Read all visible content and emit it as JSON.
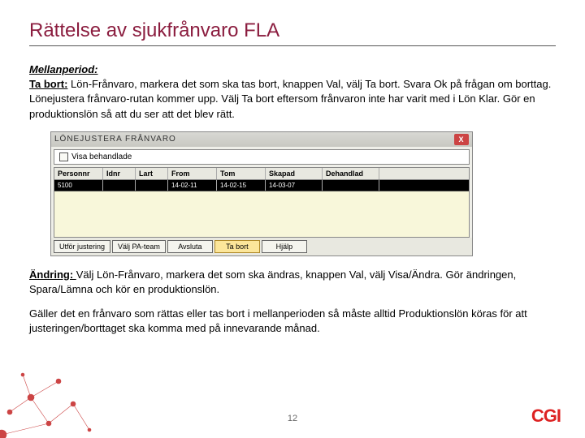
{
  "title": "Rättelse av sjukfrånvaro FLA",
  "section1_label": "Mellanperiod:",
  "section1_body_lead": "Ta bort:",
  "section1_body": " Lön-Frånvaro, markera det som ska tas bort, knappen Val, välj Ta bort. Svara Ok på frågan om borttag. Lönejustera frånvaro-rutan kommer upp. Välj Ta bort eftersom frånvaron inte har varit med i Lön Klar. Gör en produktionslön så att du ser att det blev rätt.",
  "win": {
    "title": "LÖNEJUSTERA FRÅNVARO",
    "checkbox_label": "Visa behandlade",
    "columns": [
      "Personnr",
      "Idnr",
      "Lart",
      "From",
      "Tom",
      "Skapad",
      "Dehandlad"
    ],
    "row": [
      "5100",
      "",
      "",
      "14-02-11",
      "14-02-15",
      "14-03-07",
      ""
    ],
    "buttons": [
      "Utför justering",
      "Välj PA-team",
      "Avsluta",
      "Ta bort",
      "Hjälp"
    ],
    "active_button_index": 3
  },
  "section2_lead": "Ändring: ",
  "section2_body": "Välj Lön-Frånvaro, markera det som ska ändras, knappen Val, välj Visa/Ändra. Gör ändringen, Spara/Lämna och kör en produktionslön.",
  "section3_body": "Gäller det en frånvaro som rättas eller tas bort i mellanperioden så måste alltid Produktionslön köras för att justeringen/borttaget ska komma med på innevarande månad.",
  "page_number": "12",
  "logo_text": "CGI"
}
